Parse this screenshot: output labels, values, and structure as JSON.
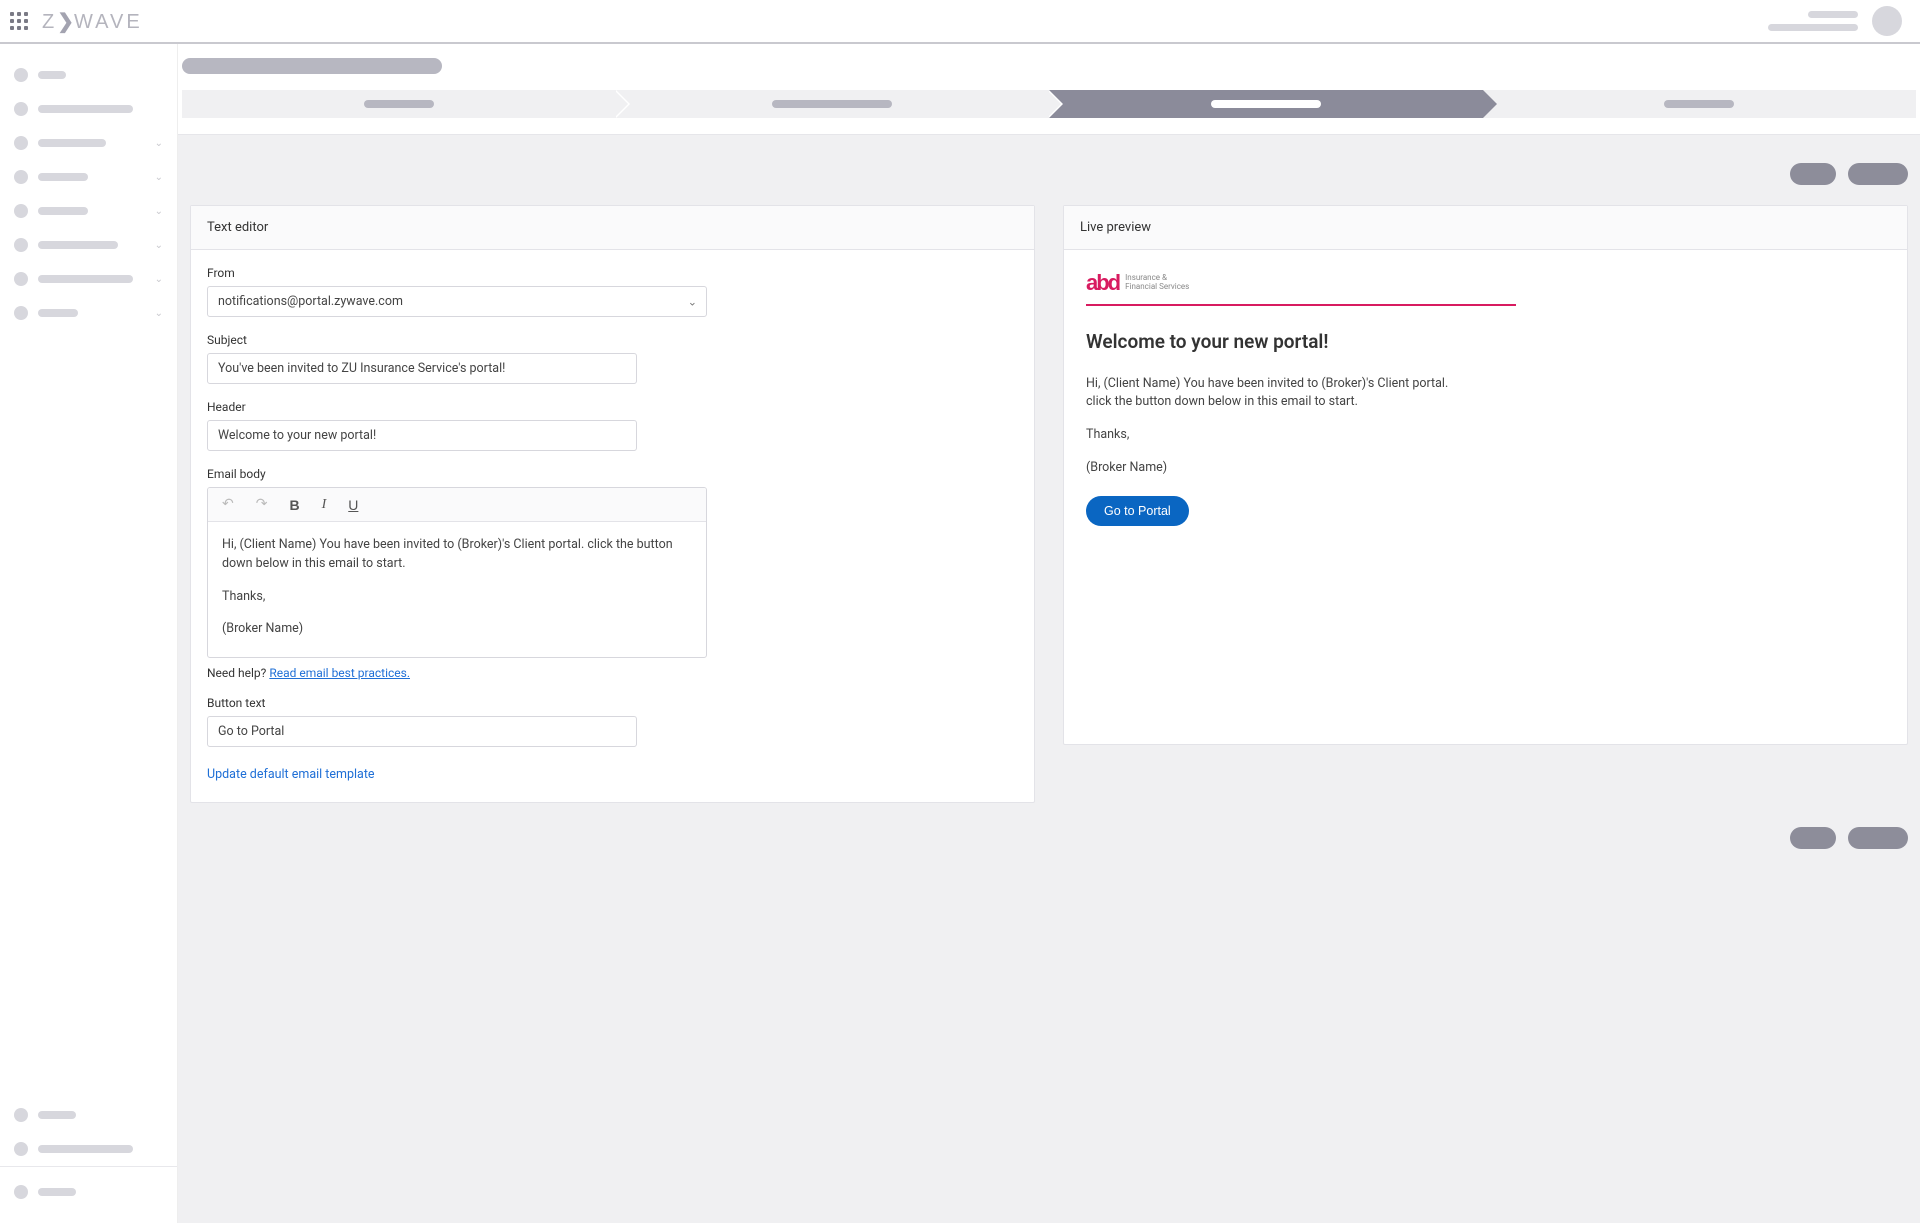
{
  "header": {
    "brand": "Z❯WAVE"
  },
  "editor": {
    "panel_title": "Text editor",
    "from_label": "From",
    "from_value": "notifications@portal.zywave.com",
    "subject_label": "Subject",
    "subject_value": "You've been invited to ZU Insurance Service's portal!",
    "header_label": "Header",
    "header_value": "Welcome to your new portal!",
    "body_label": "Email body",
    "body_para1": "Hi, (Client Name) You have been invited to (Broker)'s Client portal. click the button down below in this email to start.",
    "body_para2": "Thanks,",
    "body_para3": "(Broker Name)",
    "help_prefix": "Need help? ",
    "help_link": "Read email best practices.",
    "button_text_label": "Button text",
    "button_text_value": "Go to Portal",
    "update_template_link": "Update default email template"
  },
  "preview": {
    "panel_title": "Live preview",
    "brand_name": "abd",
    "brand_sub1": "Insurance &",
    "brand_sub2": "Financial Services",
    "title": "Welcome to your new portal!",
    "line1": "Hi, (Client Name) You have been invited to (Broker)'s Client portal.",
    "line2": "click the button down below in this email to start.",
    "thanks": "Thanks,",
    "broker": "(Broker Name)",
    "cta": "Go to Portal"
  }
}
